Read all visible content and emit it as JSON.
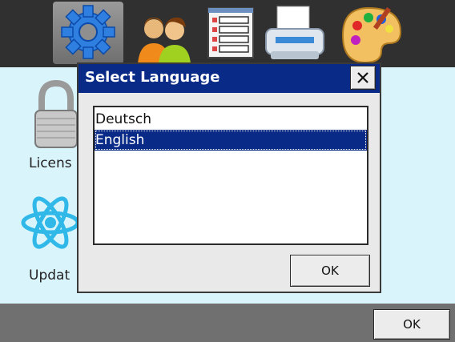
{
  "toolbar": {
    "icons": [
      "settings-gear-icon",
      "users-icon",
      "list-icon",
      "printer-icon",
      "paint-palette-icon"
    ],
    "active_icon": "settings-gear-icon"
  },
  "sidebar": {
    "items": [
      {
        "label": "Licens",
        "icon": "padlock-icon"
      },
      {
        "label": "Updat",
        "icon": "atom-icon"
      }
    ]
  },
  "dialog": {
    "title": "Select Language",
    "close_label": "✕",
    "languages": [
      {
        "label": "Deutsch",
        "selected": false
      },
      {
        "label": "English",
        "selected": true
      }
    ],
    "ok_label": "OK"
  },
  "bottombar": {
    "ok_label": "OK"
  },
  "colors": {
    "title_bar": "#0a2a88",
    "selection": "#0a2a88",
    "top_bar": "#303030",
    "background": "#d9f4fb",
    "bottom_bar": "#707070"
  }
}
